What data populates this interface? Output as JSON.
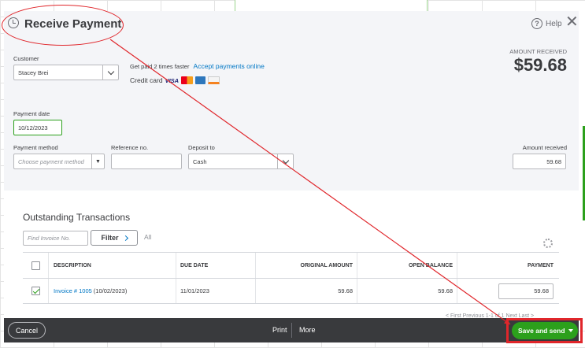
{
  "header": {
    "title": "Receive Payment",
    "help_label": "Help",
    "close_label": "✕"
  },
  "customer": {
    "label": "Customer",
    "value": "Stacey Brei"
  },
  "promo": {
    "text": "Get paid 2 times faster",
    "link": "Accept payments online",
    "credit_label": "Credit card",
    "visa": "VISA"
  },
  "amount_received_top": {
    "label": "AMOUNT RECEIVED",
    "value": "$59.68"
  },
  "payment_date": {
    "label": "Payment date",
    "value": "10/12/2023"
  },
  "payment_method": {
    "label": "Payment method",
    "placeholder": "Choose payment method"
  },
  "reference_no": {
    "label": "Reference no.",
    "value": ""
  },
  "deposit_to": {
    "label": "Deposit to",
    "value": "Cash"
  },
  "amount_received_field": {
    "label": "Amount received",
    "value": "59.68"
  },
  "outstanding": {
    "title": "Outstanding Transactions",
    "find_placeholder": "Find Invoice No.",
    "filter_label": "Filter",
    "all_label": "All",
    "columns": [
      "DESCRIPTION",
      "DUE DATE",
      "ORIGINAL AMOUNT",
      "OPEN BALANCE",
      "PAYMENT"
    ],
    "rows": [
      {
        "checked": true,
        "description_link": "Invoice # 1005",
        "description_date": "(10/02/2023)",
        "due_date": "11/01/2023",
        "original_amount": "59.68",
        "open_balance": "59.68",
        "payment": "59.68"
      }
    ],
    "pager": "< First   Previous   1-1 of 1   Next   Last >"
  },
  "footer": {
    "cancel_label": "Cancel",
    "print_label": "Print",
    "more_label": "More",
    "save_label": "Save and send"
  },
  "colors": {
    "accent_green": "#2ca01c",
    "link_blue": "#0077c5",
    "annotation_red": "#e0262b",
    "footer_dark": "#393a3d"
  }
}
